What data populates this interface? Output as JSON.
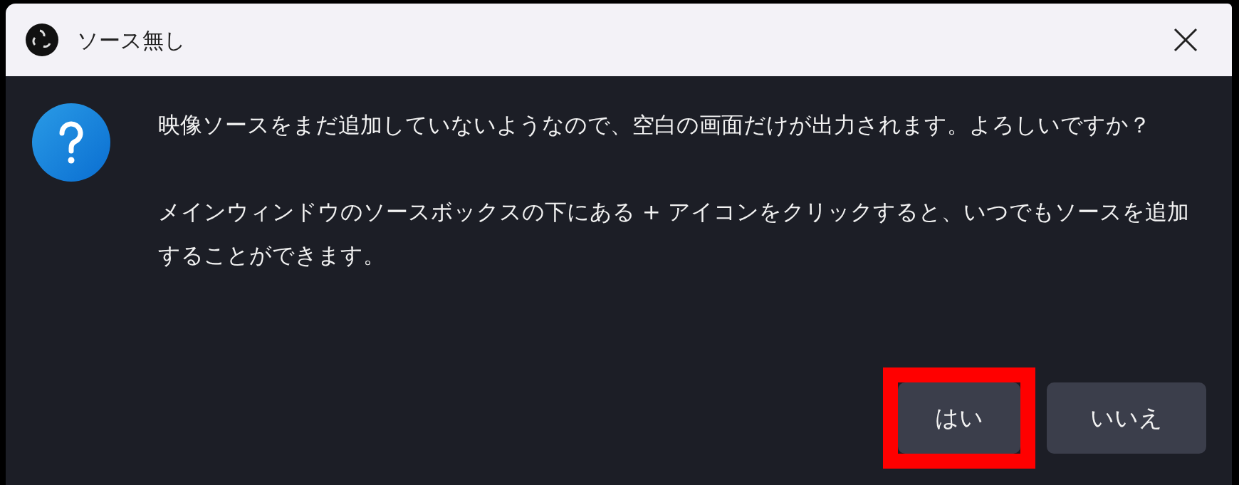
{
  "window": {
    "title": "ソース無し"
  },
  "message": {
    "paragraphs": [
      "映像ソースをまだ追加していないようなので、空白の画面だけが出力されます。よろしいですか？",
      "メインウィンドウのソースボックスの下にある + アイコンをクリックすると、いつでもソースを追加することができます。"
    ]
  },
  "buttons": [
    {
      "label": "はい",
      "highlighted": true
    },
    {
      "label": "いいえ",
      "highlighted": false
    }
  ]
}
